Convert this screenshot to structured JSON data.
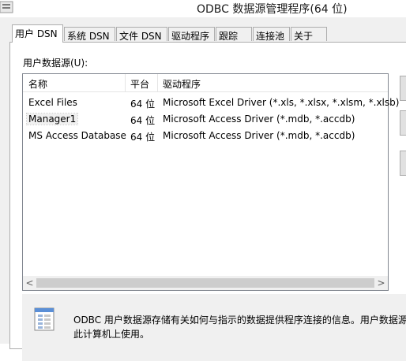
{
  "window": {
    "title": "ODBC 数据源管理程序(64 位)"
  },
  "tabs": [
    {
      "label": "用户 DSN",
      "active": true
    },
    {
      "label": "系统 DSN"
    },
    {
      "label": "文件 DSN"
    },
    {
      "label": "驱动程序"
    },
    {
      "label": "跟踪"
    },
    {
      "label": "连接池"
    },
    {
      "label": "关于"
    }
  ],
  "user_dsn": {
    "section_label": "用户数据源(U):",
    "columns": [
      "名称",
      "平台",
      "驱动程序"
    ],
    "rows": [
      {
        "name": "Excel Files",
        "platform": "64 位",
        "driver": "Microsoft Excel Driver (*.xls, *.xlsx, *.xlsm, *.xlsb)"
      },
      {
        "name": "Manager1",
        "platform": "64 位",
        "driver": "Microsoft Access Driver (*.mdb, *.accdb)",
        "selected": true
      },
      {
        "name": "MS Access Database",
        "platform": "64 位",
        "driver": "Microsoft Access Driver (*.mdb, *.accdb)"
      }
    ]
  },
  "info": {
    "line1": "ODBC 用户数据源存储有关如何与指示的数据提供程序连接的信息。用户数据源",
    "line2": "此计算机上使用。"
  },
  "scrollbar": {
    "left_arrow": "<",
    "right_arrow": ">"
  }
}
